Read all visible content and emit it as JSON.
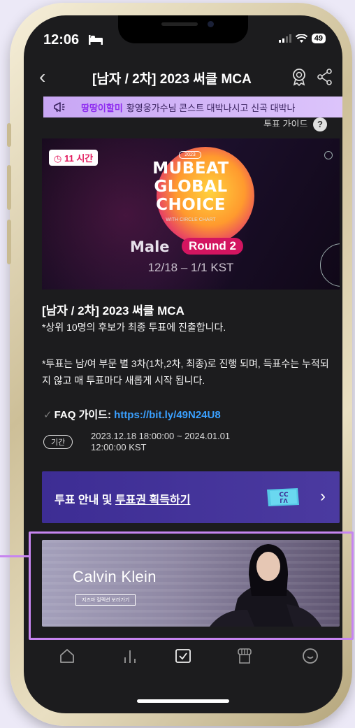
{
  "status_bar": {
    "time": "12:06",
    "battery": "49"
  },
  "header": {
    "title": "[남자 / 2차] 2023 써클 MCA"
  },
  "banner": {
    "name": "땅땅이할미",
    "message": "황영웅가수님 콘스트 대박나시고  신곡 대박나"
  },
  "vote_guide": {
    "label": "투표 가이드"
  },
  "poster": {
    "timer": "11 시간",
    "year": "2023",
    "logo_lines": [
      "MUBEAT",
      "GLOBAL",
      "CHOICE"
    ],
    "with": "WITH   CIRCLE CHART",
    "category": "Male",
    "round": "Round 2",
    "dates": "12/18 – 1/1 KST"
  },
  "main": {
    "title": "[남자 / 2차] 2023 써클 MCA",
    "desc1": "*상위 10명의 후보가 최종 투표에 진출합니다.",
    "desc2": "*투표는 남/여 부문 별 3차(1차,2차, 최종)로 진행 되며, 득표수는 누적되지 않고 매 투표마다 새롭게 시작 됩니다.",
    "faq_label": "FAQ 가이드: ",
    "faq_link": "https://bit.ly/49N24U8",
    "period_label": "기간",
    "period_start": "2023.12.18 18:00:00 ~ 2024.01.01",
    "period_end": "12:00:00 KST"
  },
  "cta": {
    "prefix": "투표 안내 및 ",
    "underlined": "투표권 획득하기"
  },
  "ad": {
    "brand": "Calvin Klein",
    "button": "지즈마 컬렉션 보러가기"
  },
  "colors": {
    "accent": "#3aa0ff",
    "cta_bg": "#3d2d94",
    "banner_name": "#8e2bf0",
    "highlight": "#c785f0",
    "timer": "#e2175b"
  }
}
